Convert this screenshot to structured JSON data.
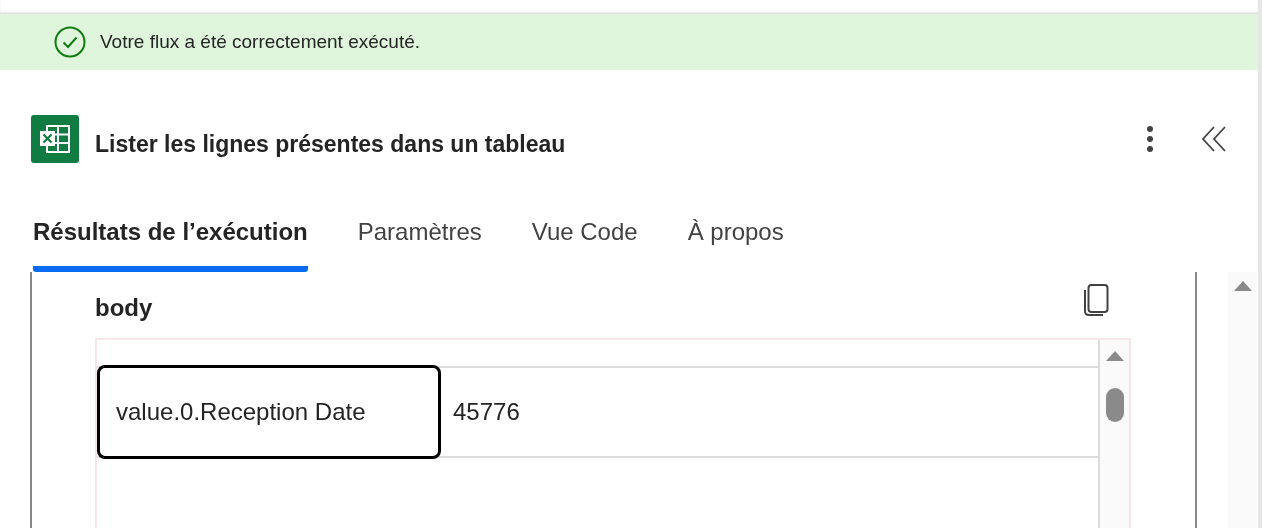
{
  "banner": {
    "message": "Votre flux a été correctement exécuté.",
    "succeeded": true
  },
  "action": {
    "title": "Lister les lignes présentes dans un tableau"
  },
  "tabs": [
    {
      "label": "Résultats de l’exécution",
      "selected": true
    },
    {
      "label": "Paramètres",
      "selected": false
    },
    {
      "label": "Vue Code",
      "selected": false
    },
    {
      "label": "À propos",
      "selected": false
    }
  ],
  "section": {
    "title": "body"
  },
  "rows": [
    {
      "key": "value.0.Reception Date",
      "value": "45776",
      "selected": true
    }
  ]
}
